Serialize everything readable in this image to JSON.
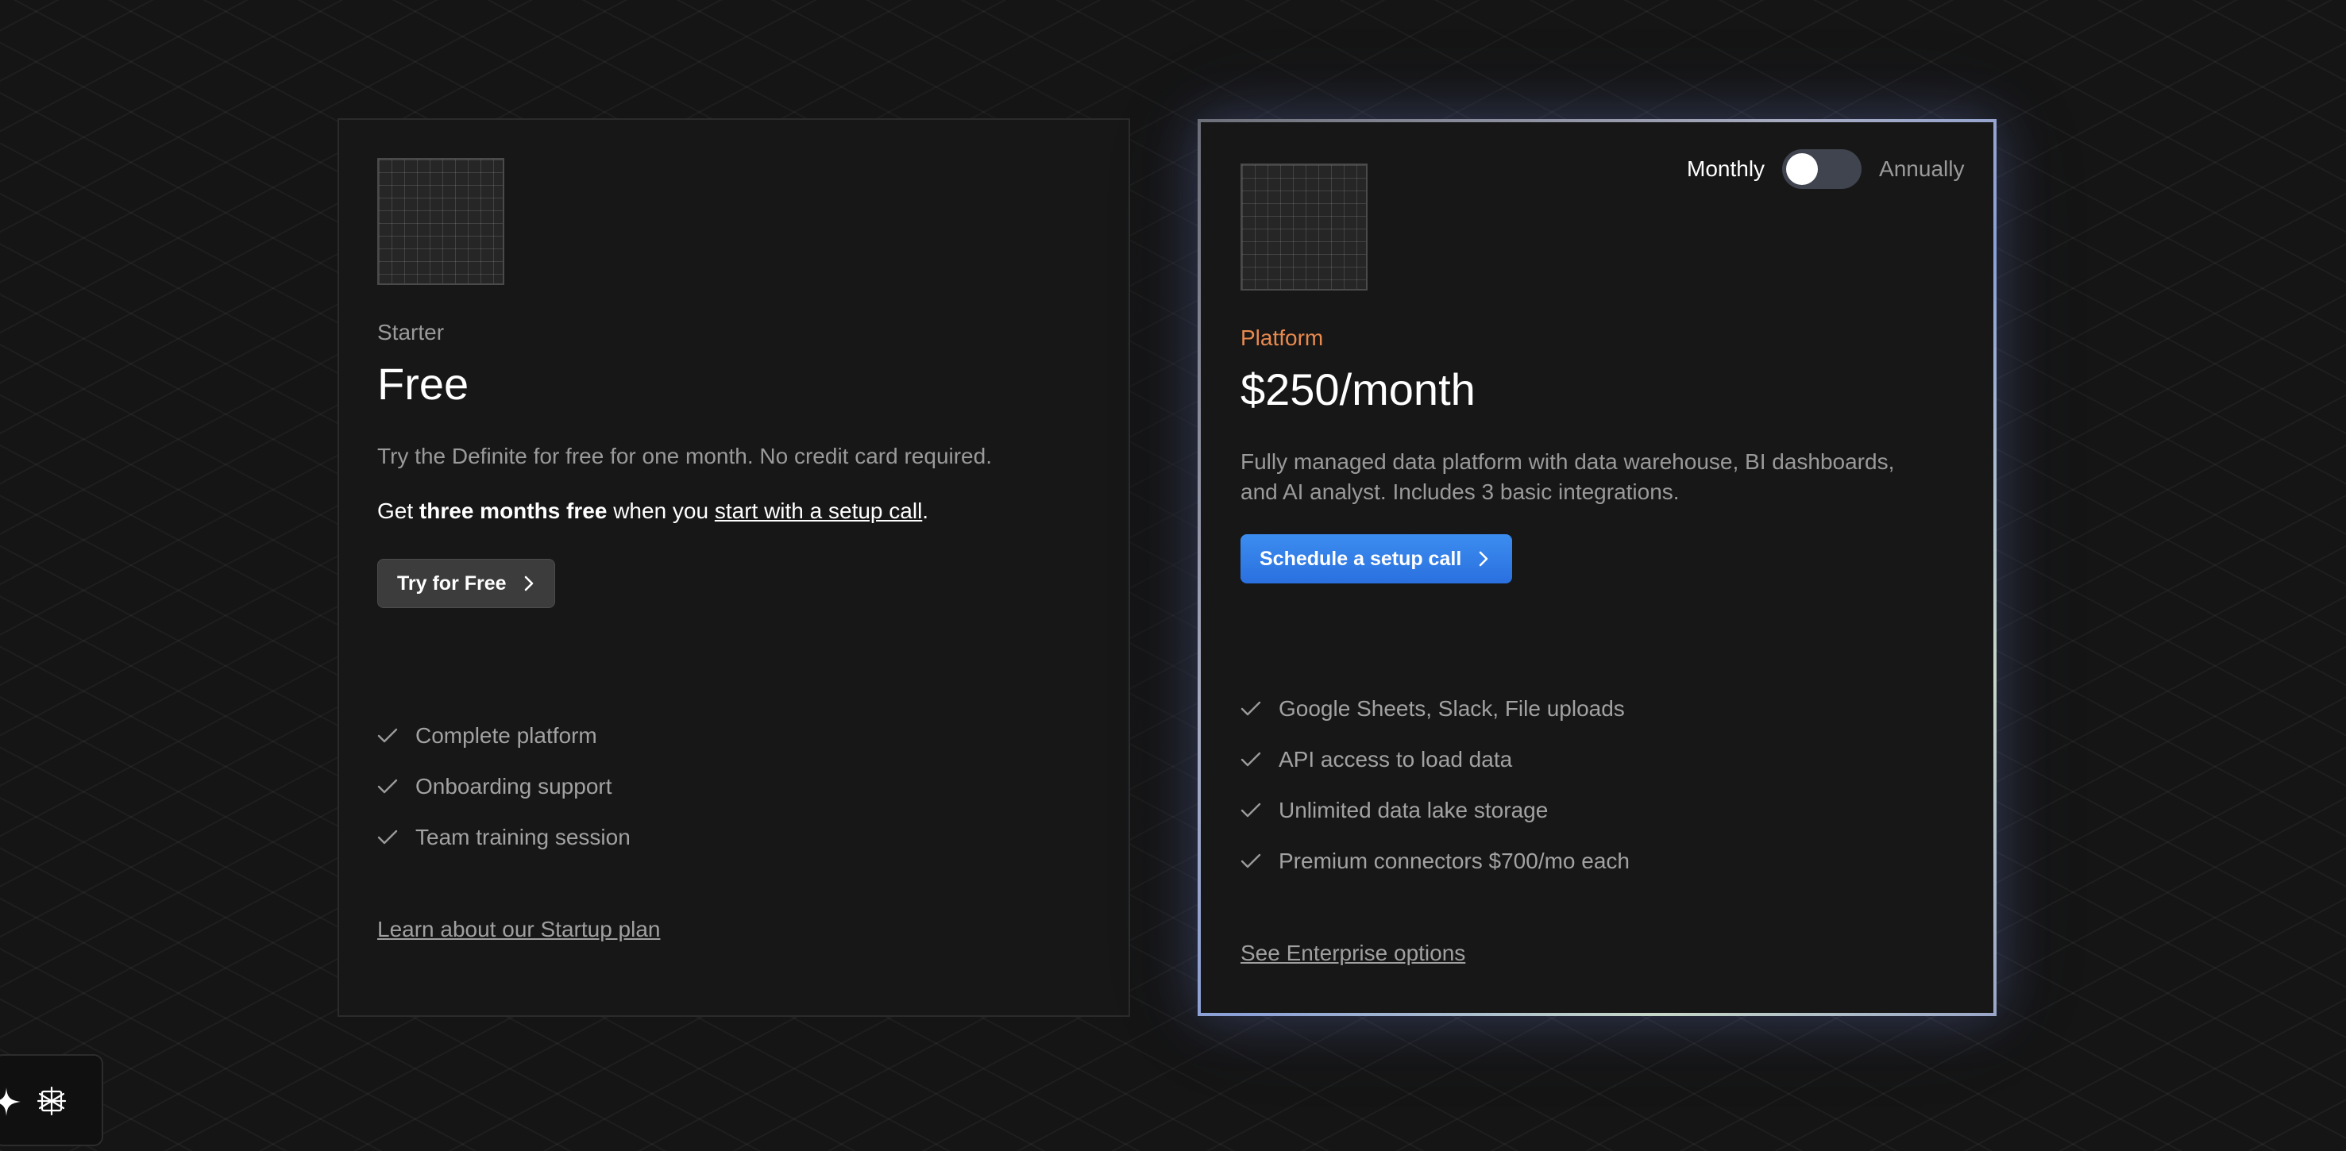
{
  "starter": {
    "tier": "Starter",
    "price": "Free",
    "description": "Try the Definite for free for one month. No credit card required.",
    "promo_prefix": "Get ",
    "promo_bold": "three months free",
    "promo_middle": " when you ",
    "promo_link": "start with a setup call",
    "promo_suffix": ".",
    "button_label": "Try for Free",
    "features": [
      "Complete platform",
      "Onboarding support",
      "Team training session"
    ],
    "bottom_link": "Learn about our Startup plan"
  },
  "platform": {
    "tier": "Platform",
    "price": "$250/month",
    "description_line1": "Fully managed data platform with data warehouse, BI dashboards,",
    "description_line2": "and AI analyst. Includes 3 basic integrations.",
    "button_label": "Schedule a setup call",
    "features": [
      "Google Sheets, Slack, File uploads",
      "API access to load data",
      "Unlimited data lake storage",
      "Premium connectors $700/mo each"
    ],
    "bottom_link": "See Enterprise options"
  },
  "billing_toggle": {
    "left_label": "Monthly",
    "right_label": "Annually",
    "selected": "Monthly"
  },
  "colors": {
    "platform_accent": "#e98a4e",
    "primary_button": "#2f7be6",
    "secondary_button": "#3c3c3c"
  },
  "icons": {
    "check": "check-icon",
    "chevron": "chevron-right-icon",
    "widget_left": "sparkle-icon",
    "widget_right": "network-icon"
  }
}
